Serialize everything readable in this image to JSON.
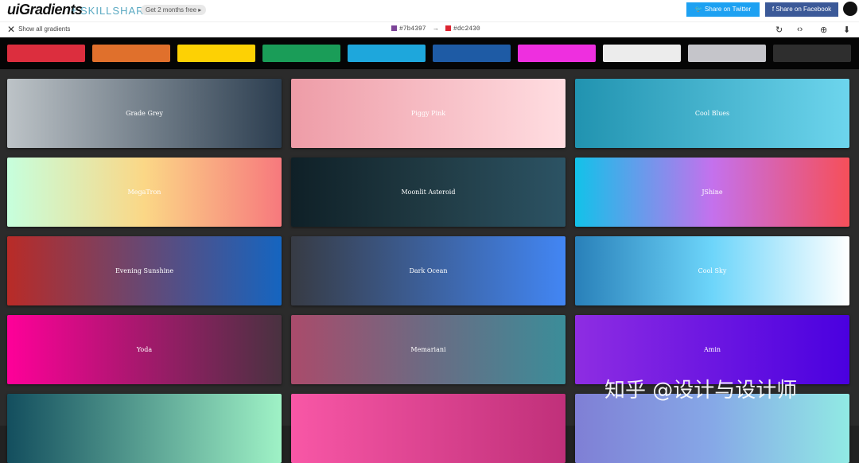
{
  "header": {
    "logo": "uiGradients",
    "plus": "+",
    "partner": "SKILLSHARE",
    "promo": "Get 2 months free ▸",
    "share_twitter": "Share on Twitter",
    "share_facebook": "Share on Facebook",
    "github_icon": "github-icon"
  },
  "subbar": {
    "show_all": "Show all gradients",
    "color_from": "#7b4397",
    "arrow": "→",
    "color_to": "#dc2430",
    "swatch_from": "#7b4397",
    "swatch_to": "#dc2430",
    "tools": [
      "↻",
      "‹›",
      "⊕",
      "⬇"
    ]
  },
  "palette": {
    "colors": [
      "#dc2e3e",
      "#e0702c",
      "#fdd104",
      "#1a9d58",
      "#1ea7dc",
      "#1e5ba5",
      "#ee2fdf",
      "#ececec",
      "#c5c5ca",
      "#2e2e2e"
    ]
  },
  "gradients": [
    {
      "name": "Grade Grey",
      "from": "#bdc3c7",
      "to": "#2c3e50"
    },
    {
      "name": "Piggy Pink",
      "from": "#ee9ca7",
      "to": "#ffdde1"
    },
    {
      "name": "Cool Blues",
      "from": "#2193b0",
      "to": "#6dd5ed"
    },
    {
      "name": "MegaTron",
      "from": "#c6ffdd",
      "mid": "#fbd786",
      "to": "#f7797d"
    },
    {
      "name": "Moonlit Asteroid",
      "from": "#0f2027",
      "mid": "#203a43",
      "to": "#2c5364"
    },
    {
      "name": "JShine",
      "from": "#12c2e9",
      "mid": "#c471ed",
      "to": "#f64f59"
    },
    {
      "name": "Evening Sunshine",
      "from": "#b92b27",
      "to": "#1565c0"
    },
    {
      "name": "Dark Ocean",
      "from": "#373b44",
      "to": "#4286f4"
    },
    {
      "name": "Cool Sky",
      "from": "#2980b9",
      "mid": "#6dd5fa",
      "to": "#ffffff"
    },
    {
      "name": "Yoda",
      "from": "#ff0099",
      "to": "#493240"
    },
    {
      "name": "Memariani",
      "from": "#aa4b6b",
      "mid": "#6b6b83",
      "to": "#3b8d99"
    },
    {
      "name": "Amin",
      "from": "#8e2de2",
      "to": "#4a00e0"
    },
    {
      "name": "",
      "from": "#134e5e",
      "to": "#9ff2c6"
    },
    {
      "name": "",
      "from": "#f857a6",
      "to": "#c0307a"
    },
    {
      "name": "",
      "from": "#7f7fd5",
      "mid": "#86a8e7",
      "to": "#91eae4"
    }
  ],
  "watermark": "知乎 @设计与设计师"
}
